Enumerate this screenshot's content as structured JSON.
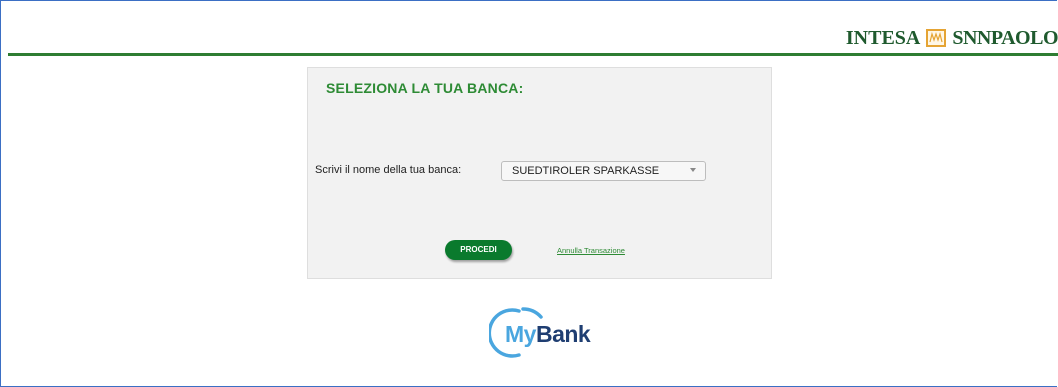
{
  "header": {
    "logo_left": "INTESA",
    "logo_right": "SNNPAOLO",
    "logo_seal_icon": "intesa-sanpaolo-seal-icon",
    "colors": {
      "rule": "#2e7d32",
      "logo_text": "#1f5a2e",
      "seal": "#e5a434"
    }
  },
  "panel": {
    "title": "SELEZIONA LA TUA BANCA:",
    "bank_label": "Scrivi il nome della tua banca:",
    "bank_select": {
      "selected": "SUEDTIROLER SPARKASSE"
    },
    "proceed_label": "PROCEDI",
    "cancel_label": "Annulla Transazione",
    "colors": {
      "title": "#2e8b35",
      "button": "#0a7a2d",
      "background": "#f2f2f2"
    }
  },
  "footer_logo": {
    "my": "My",
    "bank": "Bank",
    "colors": {
      "my": "#4aa6df",
      "bank": "#1f3e72"
    }
  }
}
